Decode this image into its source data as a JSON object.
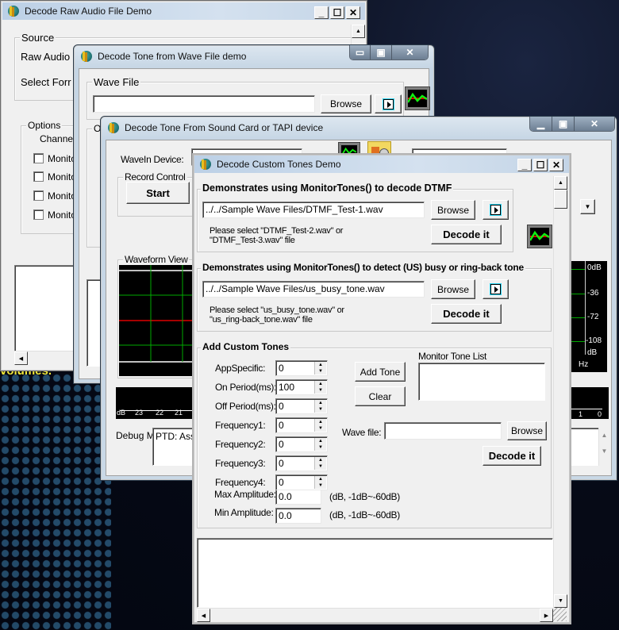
{
  "desktop": {
    "background_text": "volumes."
  },
  "win_raw": {
    "title": "Decode Raw Audio File Demo",
    "controls": {
      "minimize": "_",
      "maximize": "☐",
      "close": "✕"
    },
    "source_group": "Source",
    "raw_audio_label": "Raw Audio",
    "select_format_label": "Select Forr",
    "options_group": "Options",
    "channel_label": "Channe",
    "monitor_items": [
      "Monito",
      "Monito",
      "Monito",
      "Monito"
    ]
  },
  "win_wave": {
    "title": "Decode Tone from Wave File demo",
    "wave_file_group": "Wave File",
    "wave_file_value": "",
    "browse_label": "Browse",
    "options_group_partial": "O"
  },
  "win_sound": {
    "title": "Decode Tone From Sound Card or TAPI device",
    "wavein_label": "WaveIn Device:",
    "record_control_group": "Record Control",
    "start_label": "Start",
    "waveform_group": "Waveform View",
    "spectrum_db_labels": [
      "0dB",
      "-36",
      "-72",
      "-108",
      "dB"
    ],
    "spectrum_hz_label": "Hz",
    "level_scale_labels": [
      "dB",
      "23",
      "22",
      "21"
    ],
    "level_scale_right": [
      "1",
      "0"
    ],
    "debug_label": "Debug Message:",
    "debug_value": "PTD: Ass"
  },
  "win_custom": {
    "title": "Decode Custom Tones Demo",
    "dtmf_group": "Demonstrates using MonitorTones() to decode DTMF",
    "dtmf_file": "../../Sample Wave Files/DTMF_Test-1.wav",
    "dtmf_hint_line1": "Please select \"DTMF_Test-2.wav\" or",
    "dtmf_hint_line2": "\"DTMF_Test-3.wav\" file",
    "busy_group": "Demonstrates using MonitorTones() to detect (US) busy or ring-back tone",
    "busy_file": "../../Sample Wave Files/us_busy_tone.wav",
    "busy_hint_line1": "Please select \"us_busy_tone.wav\" or",
    "busy_hint_line2": "\"us_ring-back_tone.wav\" file",
    "browse_label": "Browse",
    "decode_label": "Decode it",
    "custom_group": "Add Custom Tones",
    "fields": [
      {
        "label": "AppSpecific:",
        "value": "0"
      },
      {
        "label": "On Period(ms):",
        "value": "100"
      },
      {
        "label": "Off Period(ms):",
        "value": "0"
      },
      {
        "label": "Frequency1:",
        "value": "0"
      },
      {
        "label": "Frequency2:",
        "value": "0"
      },
      {
        "label": "Frequency3:",
        "value": "0"
      },
      {
        "label": "Frequency4:",
        "value": "0"
      }
    ],
    "max_amp_label": "Max Amplitude:",
    "max_amp_value": "0.0",
    "min_amp_label": "Min Amplitude:",
    "min_amp_value": "0.0",
    "amp_hint": "(dB, -1dB~-60dB)",
    "add_tone_label": "Add Tone",
    "clear_label": "Clear",
    "monitor_list_label": "Monitor Tone List",
    "wave_file_label": "Wave file:",
    "wave_file_value": "",
    "output_text": ""
  }
}
